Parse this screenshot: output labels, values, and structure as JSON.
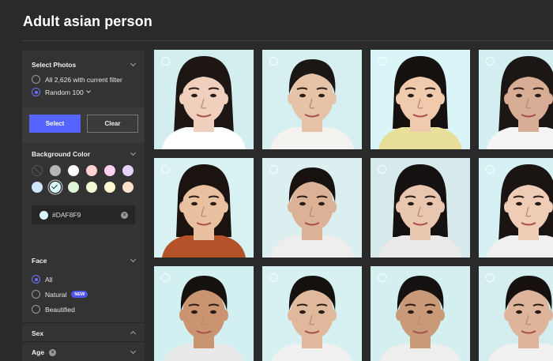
{
  "page": {
    "title": "Adult asian person"
  },
  "select_photos": {
    "heading": "Select Photos",
    "option_all": "All 2,626 with current filter",
    "option_random": "Random 100",
    "select_label": "Select",
    "clear_label": "Clear"
  },
  "background_color": {
    "heading": "Background Color",
    "swatches": [
      "none",
      "#b5b5b5",
      "#ffffff",
      "#ffd3d3",
      "#ffd1f0",
      "#e3d5ff",
      "#cfe6ff",
      "#DAF8F9",
      "#e0f7d5",
      "#f5f8d5",
      "#fff5d0",
      "#ffe2cc"
    ],
    "selected": "#DAF8F9",
    "hex_value": "#DAF8F9"
  },
  "face": {
    "heading": "Face",
    "options": [
      "All",
      "Natural",
      "Beautified"
    ],
    "selected": "All",
    "new_badge": "NEW"
  },
  "sex": {
    "heading": "Sex"
  },
  "age": {
    "heading": "Age"
  },
  "photos": [
    {
      "bg": "#d3eeef",
      "skin": "#f0d0bd",
      "hair": "#1e1612",
      "shirt": "#ffffff",
      "style": "long"
    },
    {
      "bg": "#d6eff0",
      "skin": "#e6c2a6",
      "hair": "#1a1714",
      "shirt": "#f4f2ee",
      "style": "short"
    },
    {
      "bg": "#d9f5f7",
      "skin": "#efcaad",
      "hair": "#15110e",
      "shirt": "#e7df9a",
      "style": "bob"
    },
    {
      "bg": "#d4eff1",
      "skin": "#d8ad96",
      "hair": "#1c1715",
      "shirt": "#f5f5f5",
      "style": "long"
    },
    {
      "bg": "#d8f2f3",
      "skin": "#e9c0a0",
      "hair": "#1a1310",
      "shirt": "#b4532a",
      "style": "bob"
    },
    {
      "bg": "#dbeef0",
      "skin": "#dcb296",
      "hair": "#17120f",
      "shirt": "#eeeeee",
      "style": "short"
    },
    {
      "bg": "#d6e9eb",
      "skin": "#e8c6b0",
      "hair": "#141110",
      "shirt": "#eaeaea",
      "style": "bob"
    },
    {
      "bg": "#d6f1f3",
      "skin": "#efccb6",
      "hair": "#1a1412",
      "shirt": "#f0f0f0",
      "style": "long"
    },
    {
      "bg": "#d2f0f2",
      "skin": "#c9946f",
      "hair": "#15110f",
      "shirt": "#e9e9e9",
      "style": "short"
    },
    {
      "bg": "#d7f0f1",
      "skin": "#e0b89b",
      "hair": "#15110f",
      "shirt": "#f0f0f0",
      "style": "short"
    },
    {
      "bg": "#d3eff0",
      "skin": "#c99a77",
      "hair": "#141110",
      "shirt": "#eeeeee",
      "style": "short"
    },
    {
      "bg": "#d4eef0",
      "skin": "#deb59a",
      "hair": "#16110e",
      "shirt": "#f0f0f0",
      "style": "short"
    }
  ]
}
